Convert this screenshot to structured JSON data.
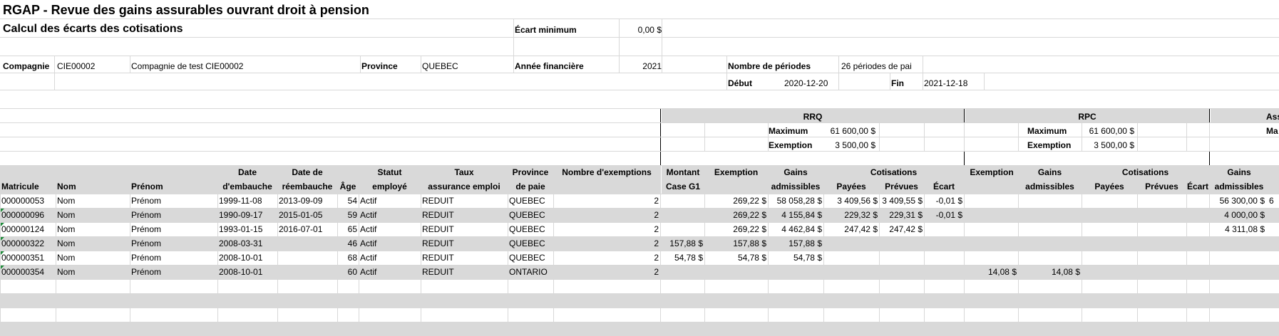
{
  "title": "RGAP - Revue des gains assurables ouvrant droit à pension",
  "subtitle": "Calcul des écarts des cotisations",
  "ecart_min_label": "Écart minimum",
  "ecart_min_value": "0,00 $",
  "info": {
    "compagnie_label": "Compagnie",
    "compagnie_code": "CIE00002",
    "compagnie_name": "Compagnie de test CIE00002",
    "province_label": "Province",
    "province_value": "QUEBEC",
    "annee_label": "Année financière",
    "annee_value": "2021",
    "periodes_label": "Nombre de périodes",
    "periodes_value": "26 périodes de pai",
    "debut_label": "Début",
    "debut_value": "2020-12-20",
    "fin_label": "Fin",
    "fin_value": "2021-12-18"
  },
  "rrq": {
    "label": "RRQ",
    "max_label": "Maximum",
    "max_value": "61 600,00 $",
    "exemption_label": "Exemption",
    "exemption_value": "3 500,00 $"
  },
  "rpc": {
    "label": "RPC",
    "max_label": "Maximum",
    "max_value": "61 600,00 $",
    "exemption_label": "Exemption",
    "exemption_value": "3 500,00 $"
  },
  "ass": {
    "label": "Ass",
    "max_label": "Ma"
  },
  "headers": {
    "matricule": "Matricule",
    "nom": "Nom",
    "prenom": "Prénom",
    "date_emb_1": "Date",
    "date_emb_2": "d'embauche",
    "date_reemb_1": "Date de",
    "date_reemb_2": "réembauche",
    "age": "Âge",
    "statut_1": "Statut",
    "statut_2": "employé",
    "taux_1": "Taux",
    "taux_2": "assurance emploi",
    "prov_1": "Province",
    "prov_2": "de paie",
    "nb_exemptions": "Nombre d'exemptions",
    "montant_1": "Montant",
    "montant_2": "Case G1",
    "exemption": "Exemption",
    "gains_1": "Gains",
    "gains_2": "admissibles",
    "cotisations": "Cotisations",
    "payees": "Payées",
    "prevues": "Prévues",
    "ecart": "Écart",
    "rpc_exemption": "Exemption",
    "rpc_gains_1": "Gains",
    "rpc_gains_2": "admissibles",
    "rpc_cotisations": "Cotisations",
    "rpc_payees": "Payées",
    "rpc_prevues": "Prévues",
    "rpc_ecart": "Écart",
    "ass_gains_1": "Gains",
    "ass_gains_2": "admissibles"
  },
  "rows": [
    {
      "mat": "000000053",
      "nom": "Nom",
      "prenom": "Prénom",
      "emb": "1999-11-08",
      "reemb": "2013-09-09",
      "age": "54",
      "statut": "Actif",
      "taux": "REDUIT",
      "prov": "QUEBEC",
      "nbex": "2",
      "montant": "",
      "exemp": "269,22 $",
      "gains": "58 058,28 $",
      "payees": "3 409,56 $",
      "prevues": "3 409,55 $",
      "ecart": "-0,01 $",
      "rpc_exemp": "",
      "rpc_gains": "",
      "ass_gains": "56 300,00 $",
      "extra": "6"
    },
    {
      "mat": "000000096",
      "nom": "Nom",
      "prenom": "Prénom",
      "emb": "1990-09-17",
      "reemb": "2015-01-05",
      "age": "59",
      "statut": "Actif",
      "taux": "REDUIT",
      "prov": "QUEBEC",
      "nbex": "2",
      "montant": "",
      "exemp": "269,22 $",
      "gains": "4 155,84 $",
      "payees": "229,32 $",
      "prevues": "229,31 $",
      "ecart": "-0,01 $",
      "rpc_exemp": "",
      "rpc_gains": "",
      "ass_gains": "4 000,00 $",
      "extra": ""
    },
    {
      "mat": "000000124",
      "nom": "Nom",
      "prenom": "Prénom",
      "emb": "1993-01-15",
      "reemb": "2016-07-01",
      "age": "65",
      "statut": "Actif",
      "taux": "REDUIT",
      "prov": "QUEBEC",
      "nbex": "2",
      "montant": "",
      "exemp": "269,22 $",
      "gains": "4 462,84 $",
      "payees": "247,42 $",
      "prevues": "247,42 $",
      "ecart": "",
      "rpc_exemp": "",
      "rpc_gains": "",
      "ass_gains": "4 311,08 $",
      "extra": ""
    },
    {
      "mat": "000000322",
      "nom": "Nom",
      "prenom": "Prénom",
      "emb": "2008-03-31",
      "reemb": "",
      "age": "46",
      "statut": "Actif",
      "taux": "REDUIT",
      "prov": "QUEBEC",
      "nbex": "2",
      "montant": "157,88 $",
      "exemp": "157,88 $",
      "gains": "157,88 $",
      "payees": "",
      "prevues": "",
      "ecart": "",
      "rpc_exemp": "",
      "rpc_gains": "",
      "ass_gains": "",
      "extra": ""
    },
    {
      "mat": "000000351",
      "nom": "Nom",
      "prenom": "Prénom",
      "emb": "2008-10-01",
      "reemb": "",
      "age": "68",
      "statut": "Actif",
      "taux": "REDUIT",
      "prov": "QUEBEC",
      "nbex": "2",
      "montant": "54,78 $",
      "exemp": "54,78 $",
      "gains": "54,78 $",
      "payees": "",
      "prevues": "",
      "ecart": "",
      "rpc_exemp": "",
      "rpc_gains": "",
      "ass_gains": "",
      "extra": ""
    },
    {
      "mat": "000000354",
      "nom": "Nom",
      "prenom": "Prénom",
      "emb": "2008-10-01",
      "reemb": "",
      "age": "60",
      "statut": "Actif",
      "taux": "REDUIT",
      "prov": "ONTARIO",
      "nbex": "2",
      "montant": "",
      "exemp": "",
      "gains": "",
      "payees": "",
      "prevues": "",
      "ecart": "",
      "rpc_exemp": "14,08 $",
      "rpc_gains": "14,08 $",
      "ass_gains": "",
      "extra": ""
    }
  ]
}
